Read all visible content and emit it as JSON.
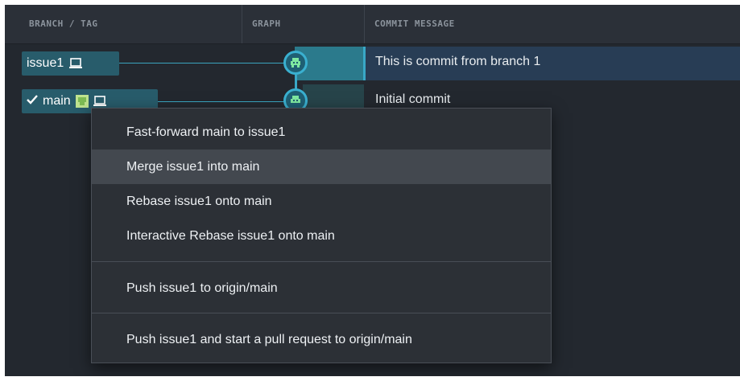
{
  "header": {
    "columns": [
      "BRANCH / TAG",
      "GRAPH",
      "COMMIT MESSAGE"
    ]
  },
  "branches": {
    "issue1": {
      "label": "issue1",
      "icon": "laptop-icon"
    },
    "main": {
      "label": "main",
      "check_icon": "checkmark-icon",
      "avatar_icon": "avatar-icon",
      "icon": "laptop-icon"
    }
  },
  "commits": [
    {
      "message": "This is commit from branch 1",
      "selected": true
    },
    {
      "message": "Initial commit",
      "selected": false
    }
  ],
  "context_menu": {
    "items": [
      {
        "label": "Fast-forward main to issue1"
      },
      {
        "label": "Merge issue1 into main",
        "hovered": true
      },
      {
        "label": "Rebase issue1 onto main"
      },
      {
        "label": "Interactive Rebase issue1 onto main"
      },
      {
        "label": "Push issue1 to origin/main"
      },
      {
        "label": "Push issue1 and start a pull request to origin/main"
      }
    ]
  },
  "colors": {
    "background": "#23282f",
    "branch_tag": "#285c6b",
    "selected_row": "#283d55",
    "graph_accent": "#39a8c7",
    "menu_bg": "#2c3036",
    "menu_hover": "#43484f"
  }
}
